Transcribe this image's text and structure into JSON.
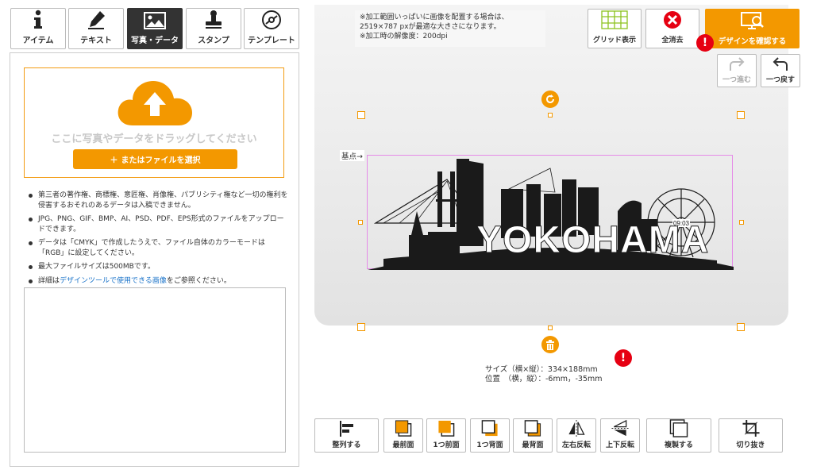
{
  "tabs": [
    {
      "label": "アイテム",
      "icon": "info-icon"
    },
    {
      "label": "テキスト",
      "icon": "pen-icon"
    },
    {
      "label": "写真・データ",
      "icon": "image-icon"
    },
    {
      "label": "スタンプ",
      "icon": "stamp-icon"
    },
    {
      "label": "テンプレート",
      "icon": "template-disc-icon"
    }
  ],
  "upload": {
    "drop_text": "ここに写真やデータをドラッグしてください",
    "file_button": "またはファイルを選択",
    "file_button_prefix": "＋"
  },
  "notes": [
    "第三者の著作権、商標権、意匠権、肖像権、パブリシティ権など一切の権利を侵害するおそれのあるデータは入稿できません。",
    "JPG、PNG、GIF、BMP、AI、PSD、PDF、EPS形式のファイルをアップロードできます。",
    "データは「CMYK」で作成したうえで、ファイル自体のカラーモードは「RGB」に設定してください。",
    "最大ファイルサイズは500MBです。"
  ],
  "note_link": {
    "prefix": "詳細は",
    "link": "デザインツールで使用できる画像",
    "suffix": "をご参照ください。"
  },
  "notice": {
    "line1": "※加工範囲いっぱいに画像を配置する場合は、",
    "line2": "2519×787 pxが最適な大きさになります。",
    "line3": "※加工時の解像度：200dpi"
  },
  "toolbar": {
    "grid": "グリッド表示",
    "clear": "全消去",
    "confirm": "デザインを確認する"
  },
  "history": {
    "redo": "一つ進む",
    "undo": "一つ戻す"
  },
  "design": {
    "text": "YOKOHAMA",
    "anchor_label": "基点→"
  },
  "size_info": {
    "size_label": "サイズ（横×縦）：334×188mm",
    "pos_label": "位置　（横，縦）：-6mm，-35mm"
  },
  "bottom_buttons": [
    {
      "label": "整列する",
      "icon": "align-icon"
    },
    {
      "label": "最前面",
      "icon": "bring-front-icon"
    },
    {
      "label": "1つ前面",
      "icon": "bring-forward-icon"
    },
    {
      "label": "1つ背面",
      "icon": "send-backward-icon"
    },
    {
      "label": "最背面",
      "icon": "send-back-icon"
    },
    {
      "label": "左右反転",
      "icon": "flip-horizontal-icon"
    },
    {
      "label": "上下反転",
      "icon": "flip-vertical-icon"
    },
    {
      "label": "複製する",
      "icon": "duplicate-icon"
    },
    {
      "label": "切り抜き",
      "icon": "crop-icon"
    }
  ],
  "colors": {
    "accent": "#f39800",
    "alert": "#e60012",
    "selection": "#e58ae8",
    "active_tab": "#333333"
  }
}
